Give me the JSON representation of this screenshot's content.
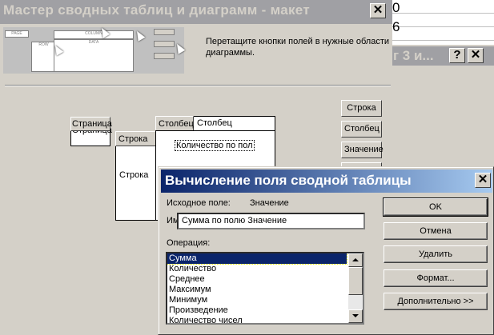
{
  "excel": {
    "row_digits": [
      "0",
      "6"
    ]
  },
  "step3": {
    "title": "г 3 и...",
    "help_glyph": "?",
    "close_glyph": "✕"
  },
  "wizard": {
    "title": "Мастер сводных таблиц и диаграмм - макет",
    "close_glyph": "✕",
    "instruction": "Перетащите кнопки полей в нужные области диаграммы.",
    "preview_labels": {
      "page": "PAGE",
      "row": "ROW",
      "column": "COLUMN",
      "data": "DATA"
    },
    "page_label": "Страница",
    "page_field": "Страница",
    "row_field": "Строка",
    "row_label": "Строка",
    "col_field": "Столбец",
    "col_label": "Столбец",
    "data_field": "Количество по пол",
    "side_buttons": [
      "Строка",
      "Столбец",
      "Значение"
    ]
  },
  "dialog": {
    "title": "Вычисление поля сводной таблицы",
    "close_glyph": "✕",
    "source_label": "Исходное поле:",
    "source_value": "Значение",
    "name_label": "Имя:",
    "name_value": "Сумма по полю Значение",
    "operation_label": "Операция:",
    "operations": [
      "Сумма",
      "Количество",
      "Среднее",
      "Максимум",
      "Минимум",
      "Произведение",
      "Количество чисел"
    ],
    "selected_operation": "Сумма",
    "buttons": {
      "ok": "OK",
      "cancel": "Отмена",
      "delete": "Удалить",
      "format": "Формат...",
      "more": "Дополнительно >>"
    }
  }
}
